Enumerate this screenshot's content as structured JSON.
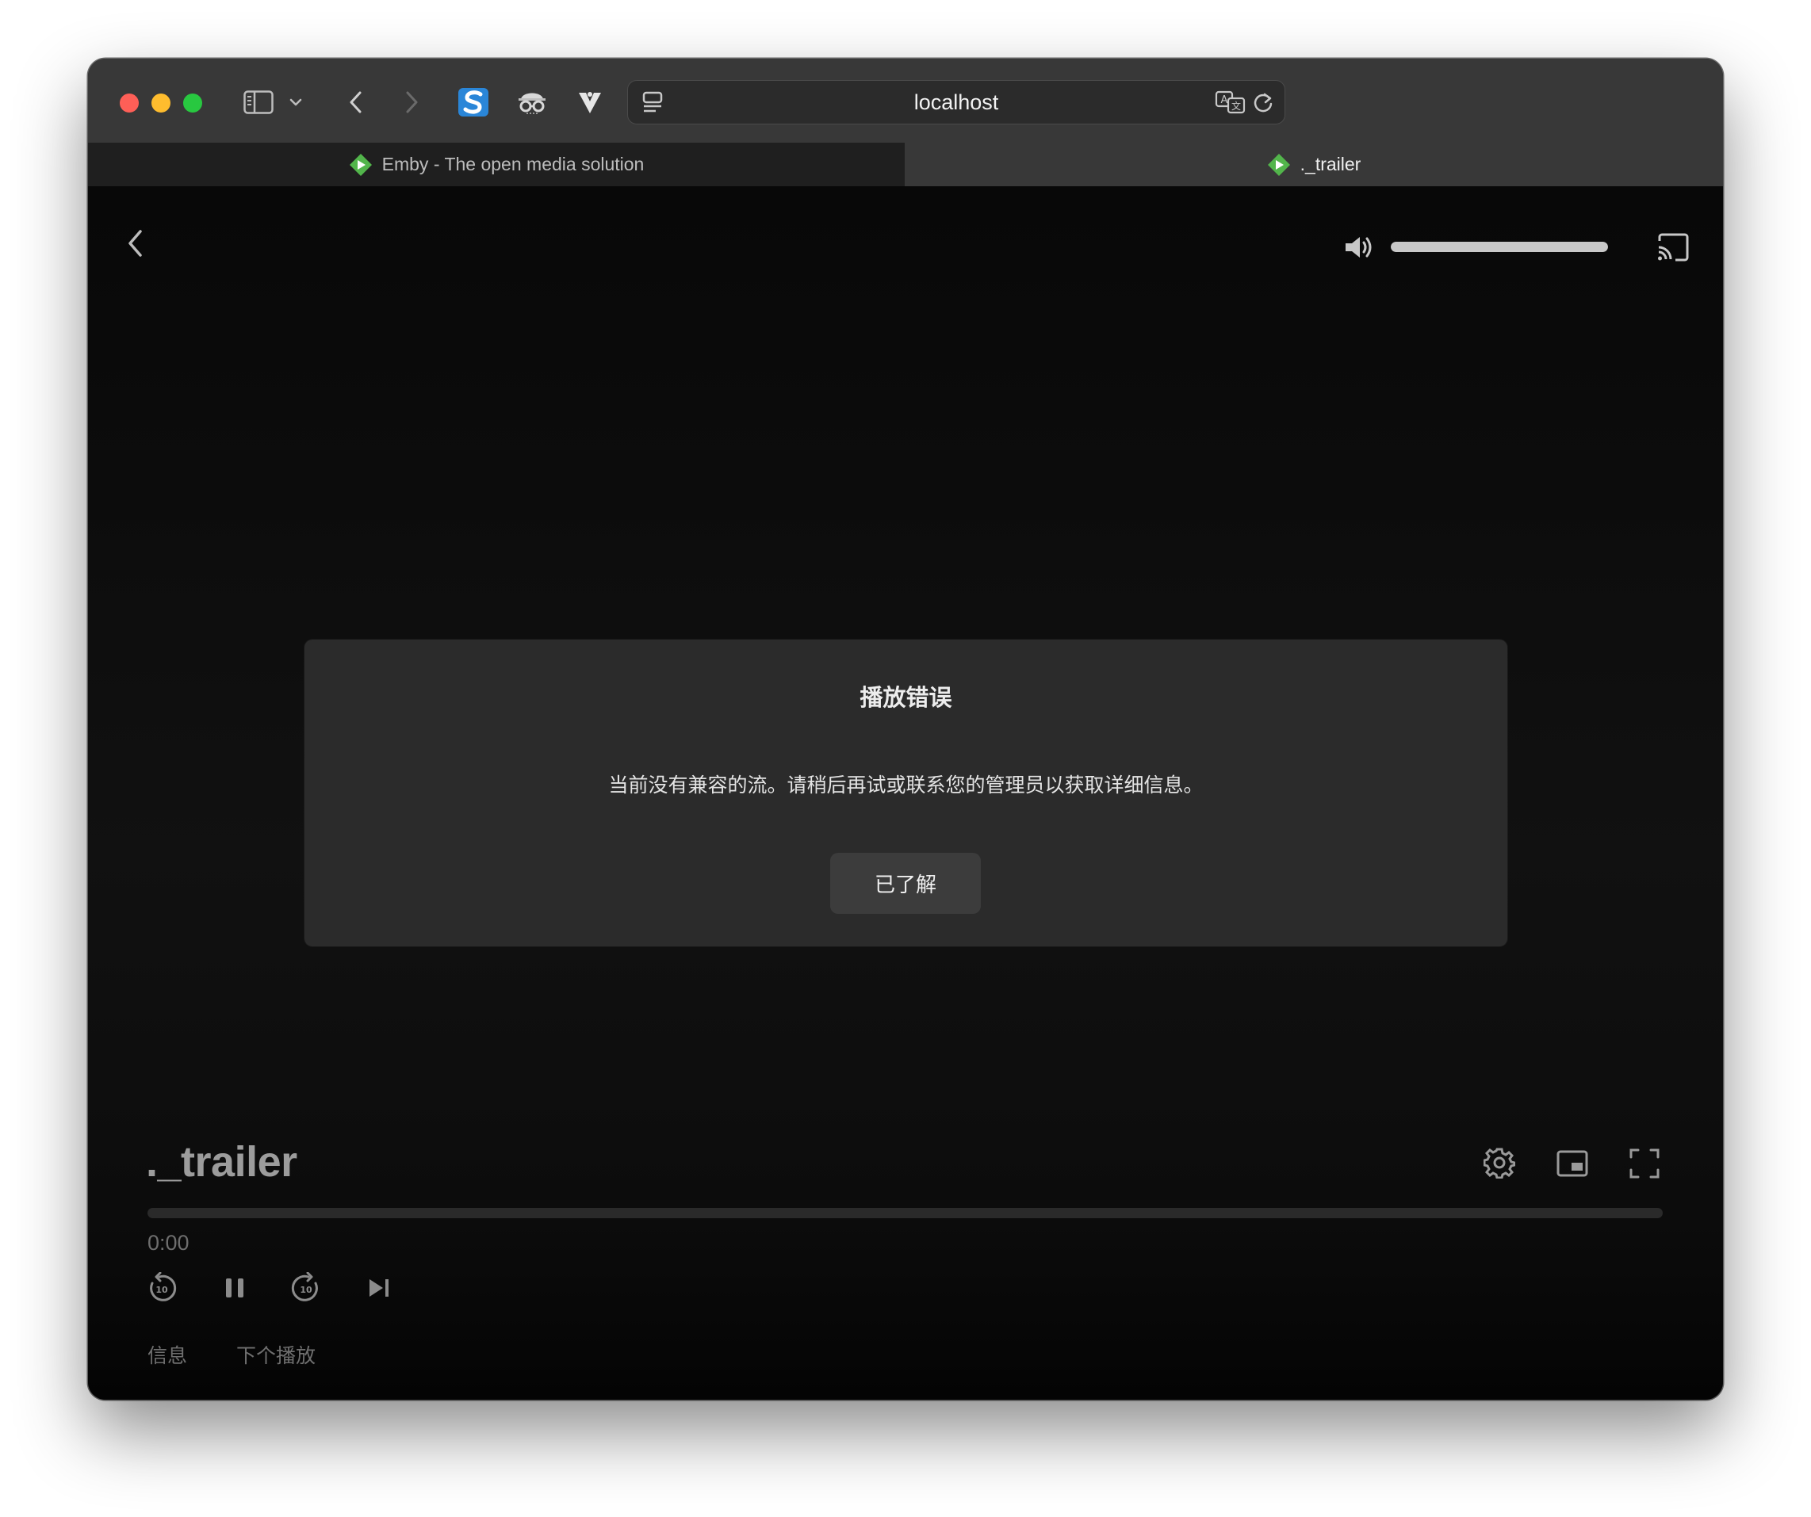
{
  "browser": {
    "url": "localhost",
    "tabs": [
      {
        "label": "Emby - The open media solution",
        "active": false
      },
      {
        "label": "._trailer",
        "active": true
      }
    ]
  },
  "player": {
    "title": "._trailer",
    "time": "0:00",
    "progress": 0.0,
    "volume": 1.0,
    "bottom_buttons": {
      "info": "信息",
      "up_next": "下个播放"
    }
  },
  "dialog": {
    "title": "播放错误",
    "message": "当前没有兼容的流。请稍后再试或联系您的管理员以获取详细信息。",
    "button": "已了解"
  },
  "colors": {
    "accent_emby": "#52b54b",
    "traffic_red": "#fe5f57",
    "traffic_yellow": "#febc2e",
    "traffic_green": "#28c840"
  }
}
